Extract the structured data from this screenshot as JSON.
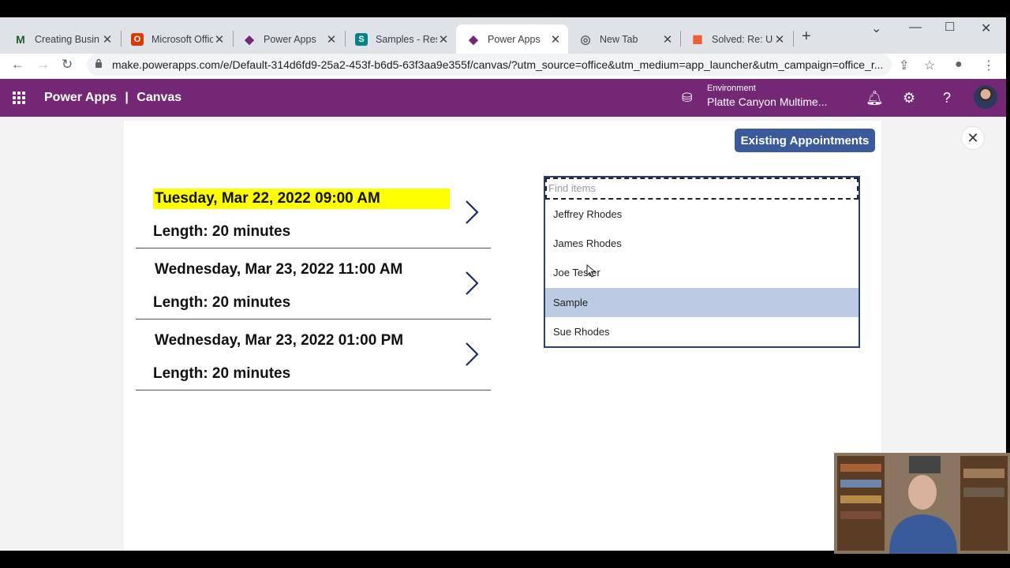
{
  "browser": {
    "tabs": [
      {
        "title": "Creating Busin",
        "favicon": "m-logo",
        "color": "#1a5c2e",
        "glyph": "M"
      },
      {
        "title": "Microsoft Offic",
        "favicon": "office-logo",
        "color": "#d83b01",
        "glyph": "O"
      },
      {
        "title": "Power Apps",
        "favicon": "powerapps-logo",
        "color": "#742774",
        "glyph": "◆"
      },
      {
        "title": "Samples - Res",
        "favicon": "sharepoint-logo",
        "color": "#038387",
        "glyph": "S"
      },
      {
        "title": "Power Apps",
        "favicon": "powerapps-logo",
        "color": "#742774",
        "glyph": "◆",
        "active": true
      },
      {
        "title": "New Tab",
        "favicon": "chrome-logo",
        "color": "#5f6368",
        "glyph": "◎"
      },
      {
        "title": "Solved: Re: Usi",
        "favicon": "microsoft-logo",
        "color": "#f25022",
        "glyph": "▦"
      }
    ],
    "url": "make.powerapps.com/e/Default-314d6fd9-25a2-453f-b6d5-63f3aa9e355f/canvas/?utm_source=office&utm_medium=app_launcher&utm_campaign=office_r..."
  },
  "app": {
    "name": "Power Apps",
    "separator": "|",
    "section": "Canvas",
    "environment_label": "Environment",
    "environment_name": "Platte Canyon Multime..."
  },
  "canvas": {
    "existing_button": "Existing Appointments",
    "appointments": [
      {
        "datetime": "Tuesday, Mar 22, 2022 09:00 AM",
        "length": "Length: 20 minutes",
        "highlighted": true
      },
      {
        "datetime": "Wednesday, Mar 23, 2022 11:00 AM",
        "length": "Length: 20 minutes",
        "highlighted": false
      },
      {
        "datetime": "Wednesday, Mar 23, 2022 01:00 PM",
        "length": "Length: 20 minutes",
        "highlighted": false
      }
    ],
    "combo": {
      "placeholder": "Find items",
      "options": [
        {
          "label": "Jeffrey Rhodes",
          "selected": false
        },
        {
          "label": "James Rhodes",
          "selected": false
        },
        {
          "label": "Joe Tester",
          "selected": false
        },
        {
          "label": "Sample",
          "selected": true
        },
        {
          "label": "Sue Rhodes",
          "selected": false
        }
      ]
    }
  },
  "colors": {
    "brand": "#742774",
    "button": "#3a5a9b",
    "highlight": "#ffff00",
    "selected_option": "#bccbe3"
  }
}
